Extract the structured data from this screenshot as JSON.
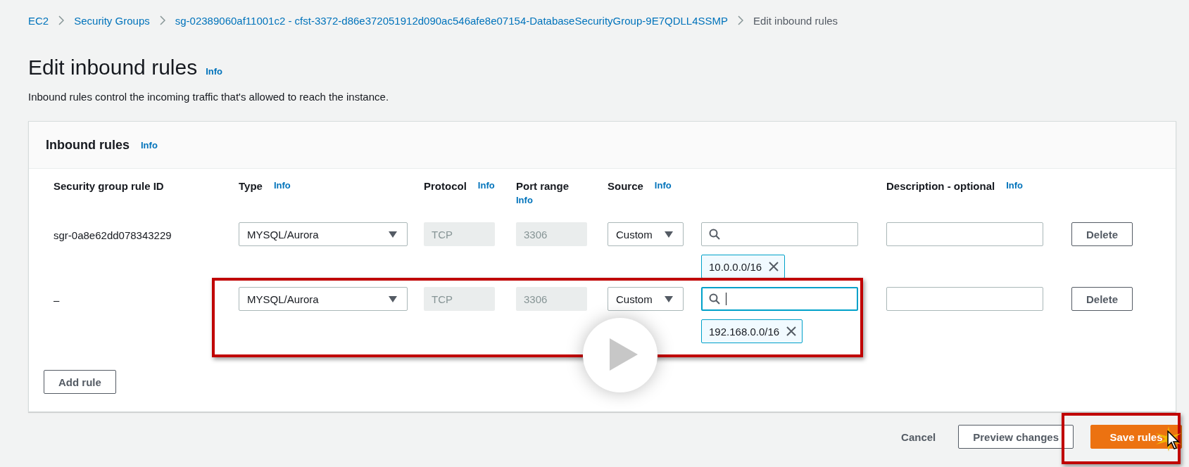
{
  "breadcrumb": [
    {
      "label": "EC2",
      "kind": "link"
    },
    {
      "label": "Security Groups",
      "kind": "link"
    },
    {
      "label": "sg-02389060af11001c2 - cfst-3372-d86e372051912d090ac546afe8e07154-DatabaseSecurityGroup-9E7QDLL4SSMP",
      "kind": "link"
    },
    {
      "label": "Edit inbound rules",
      "kind": "current"
    }
  ],
  "title": "Edit inbound rules",
  "title_info": "Info",
  "description": "Inbound rules control the incoming traffic that's allowed to reach the instance.",
  "panel": {
    "title": "Inbound rules",
    "info": "Info",
    "columns": [
      {
        "label": "Security group rule ID"
      },
      {
        "label": "Type",
        "info": "Info"
      },
      {
        "label": "Protocol",
        "info": "Info"
      },
      {
        "label": "Port range",
        "info": "Info"
      },
      {
        "label": "Source",
        "info": "Info"
      },
      {
        "label": "Description - optional",
        "info": "Info"
      }
    ],
    "rows": [
      {
        "rule_id": "sgr-0a8e62dd078343229",
        "type": "MYSQL/Aurora",
        "protocol": "TCP",
        "port_range": "3306",
        "source": "Custom",
        "source_focused": false,
        "tokens": [
          "10.0.0.0/16"
        ],
        "delete": "Delete"
      },
      {
        "rule_id": "–",
        "type": "MYSQL/Aurora",
        "protocol": "TCP",
        "port_range": "3306",
        "source": "Custom",
        "source_focused": true,
        "tokens": [
          "192.168.0.0/16"
        ],
        "delete": "Delete"
      }
    ],
    "add_rule": "Add rule"
  },
  "footer_buttons": [
    {
      "label": "Cancel",
      "kind": "link"
    },
    {
      "label": "Preview changes",
      "kind": "normal"
    },
    {
      "label": "Save rules",
      "kind": "primary"
    }
  ]
}
